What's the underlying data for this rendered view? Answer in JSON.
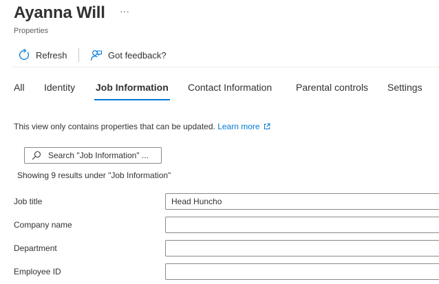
{
  "header": {
    "title": "Ayanna Will",
    "more_label": "···",
    "subtitle": "Properties"
  },
  "toolbar": {
    "refresh_label": "Refresh",
    "feedback_label": "Got feedback?"
  },
  "tabs": [
    {
      "label": "All",
      "active": false
    },
    {
      "label": "Identity",
      "active": false
    },
    {
      "label": "Job Information",
      "active": true
    },
    {
      "label": "Contact Information",
      "active": false
    },
    {
      "label": "Parental controls",
      "active": false
    },
    {
      "label": "Settings",
      "active": false
    }
  ],
  "info": {
    "text": "This view only contains properties that can be updated.",
    "link": "Learn more"
  },
  "search": {
    "placeholder": "Search \"Job Information\" ..."
  },
  "results_text": "Showing 9 results under \"Job Information\"",
  "fields": [
    {
      "label": "Job title",
      "value": "Head Huncho"
    },
    {
      "label": "Company name",
      "value": ""
    },
    {
      "label": "Department",
      "value": ""
    },
    {
      "label": "Employee ID",
      "value": ""
    }
  ],
  "colors": {
    "accent": "#0078d4",
    "text": "#323130",
    "border": "#8a8886"
  }
}
